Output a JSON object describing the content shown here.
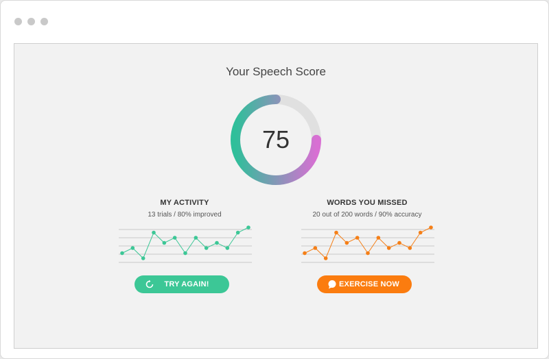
{
  "page": {
    "title": "Your Speech Score",
    "score": "75",
    "score_value": 75
  },
  "activity": {
    "title": "MY ACTIVITY",
    "subtitle": "13 trials  / 80% improved",
    "color": "#3cc796",
    "values": [
      2,
      3,
      1,
      6,
      4,
      5,
      2,
      5,
      3,
      4,
      3,
      6,
      7
    ]
  },
  "missed": {
    "title": "WORDS YOU MISSED",
    "subtitle": "20 out of 200 words / 90% accuracy",
    "color": "#f57f17",
    "values": [
      2,
      3,
      1,
      6,
      4,
      5,
      2,
      5,
      3,
      4,
      3,
      6,
      7
    ]
  },
  "buttons": {
    "try_again": {
      "label": "TRY AGAIN!",
      "icon": "refresh-icon",
      "color": "#3cc796"
    },
    "exercise": {
      "label": "EXERCISE NOW",
      "icon": "speech-bubble-icon",
      "color": "#fb7c0f"
    }
  },
  "colors": {
    "gauge_track": "#e0e0e0",
    "gauge_start": "#d86fd3",
    "gauge_end": "#2fbf9a"
  }
}
